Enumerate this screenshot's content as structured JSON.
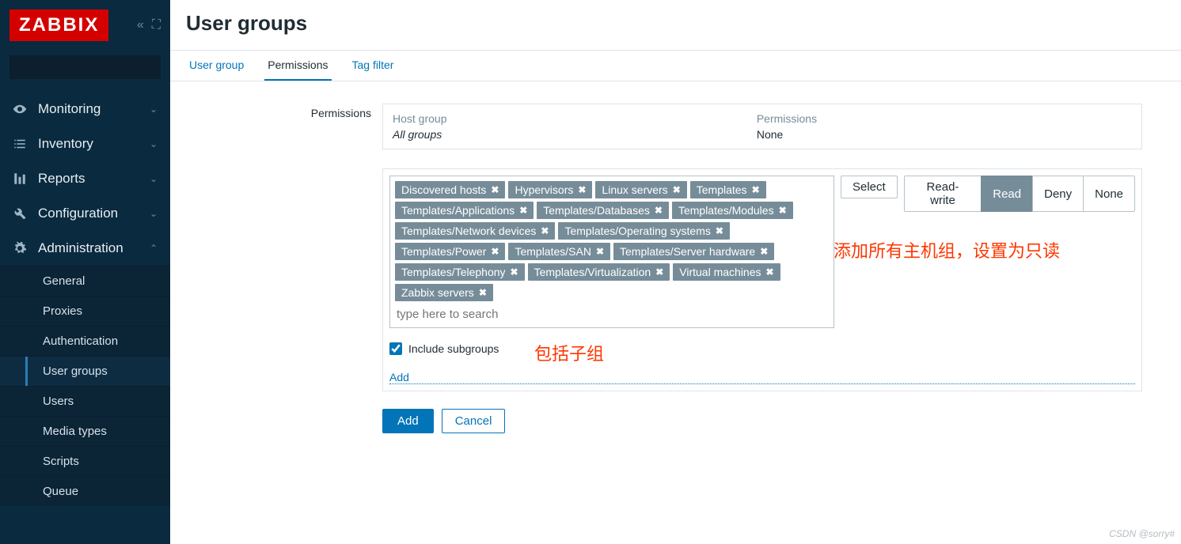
{
  "brand": "ZABBIX",
  "search": {
    "placeholder": ""
  },
  "nav": [
    {
      "icon": "eye",
      "label": "Monitoring",
      "open": false
    },
    {
      "icon": "list",
      "label": "Inventory",
      "open": false
    },
    {
      "icon": "bar",
      "label": "Reports",
      "open": false
    },
    {
      "icon": "wrench",
      "label": "Configuration",
      "open": false
    },
    {
      "icon": "gear",
      "label": "Administration",
      "open": true
    }
  ],
  "subnav": [
    "General",
    "Proxies",
    "Authentication",
    "User groups",
    "Users",
    "Media types",
    "Scripts",
    "Queue"
  ],
  "subnav_selected": "User groups",
  "page_title": "User groups",
  "tabs": [
    "User group",
    "Permissions",
    "Tag filter"
  ],
  "tab_active": "Permissions",
  "form": {
    "label": "Permissions",
    "table": {
      "head_group": "Host group",
      "head_perm": "Permissions",
      "val_group": "All groups",
      "val_perm": "None"
    },
    "tags": [
      "Discovered hosts",
      "Hypervisors",
      "Linux servers",
      "Templates",
      "Templates/Applications",
      "Templates/Databases",
      "Templates/Modules",
      "Templates/Network devices",
      "Templates/Operating systems",
      "Templates/Power",
      "Templates/SAN",
      "Templates/Server hardware",
      "Templates/Telephony",
      "Templates/Virtualization",
      "Virtual machines",
      "Zabbix servers"
    ],
    "search_placeholder": "type here to search",
    "select_btn": "Select",
    "perm_buttons": [
      "Read-write",
      "Read",
      "Deny",
      "None"
    ],
    "perm_selected": "Read",
    "include_label": "Include subgroups",
    "include_checked": true,
    "add_link": "Add",
    "submit": "Add",
    "cancel": "Cancel"
  },
  "annotations": {
    "right": "添加所有主机组，设置为只读",
    "sub": "包括子组"
  },
  "watermark": "CSDN @sorry#"
}
